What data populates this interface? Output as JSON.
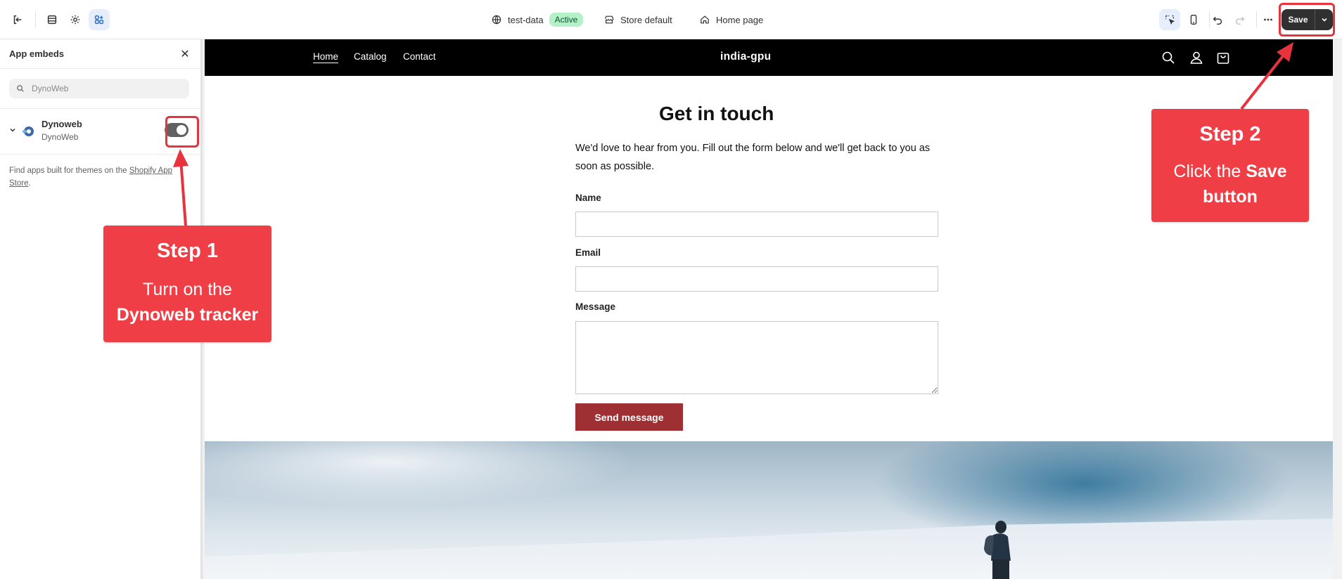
{
  "topbar": {
    "theme_name": "test-data",
    "theme_status": "Active",
    "store_context": "Store default",
    "page_template": "Home page",
    "save_label": "Save"
  },
  "sidebar": {
    "title": "App embeds",
    "search_value": "DynoWeb",
    "app": {
      "name": "Dynoweb",
      "vendor": "DynoWeb",
      "enabled": true
    },
    "footer_text": "Find apps built for themes on the ",
    "footer_link": "Shopify App Store",
    "footer_end": "."
  },
  "storefront": {
    "brand": "india-gpu",
    "nav": [
      "Home",
      "Catalog",
      "Contact"
    ],
    "contact_title": "Get in touch",
    "contact_description": "We'd love to hear from you. Fill out the form below and we'll get back to you as soon as possible.",
    "fields": {
      "name": "Name",
      "email": "Email",
      "message": "Message"
    },
    "submit_label": "Send message"
  },
  "annotations": {
    "step1": {
      "title": "Step 1",
      "line1": "Turn on the",
      "line2": "Dynoweb tracker"
    },
    "step2": {
      "title": "Step 2",
      "line1_pre": "Click the ",
      "line1_bold": "Save",
      "line2": "button"
    },
    "accent_color": "#ef3e45"
  },
  "colors": {
    "active_badge": "#b4f0c8",
    "send_button": "#9e2f33",
    "save_button": "#303030",
    "store_header": "#000000"
  }
}
